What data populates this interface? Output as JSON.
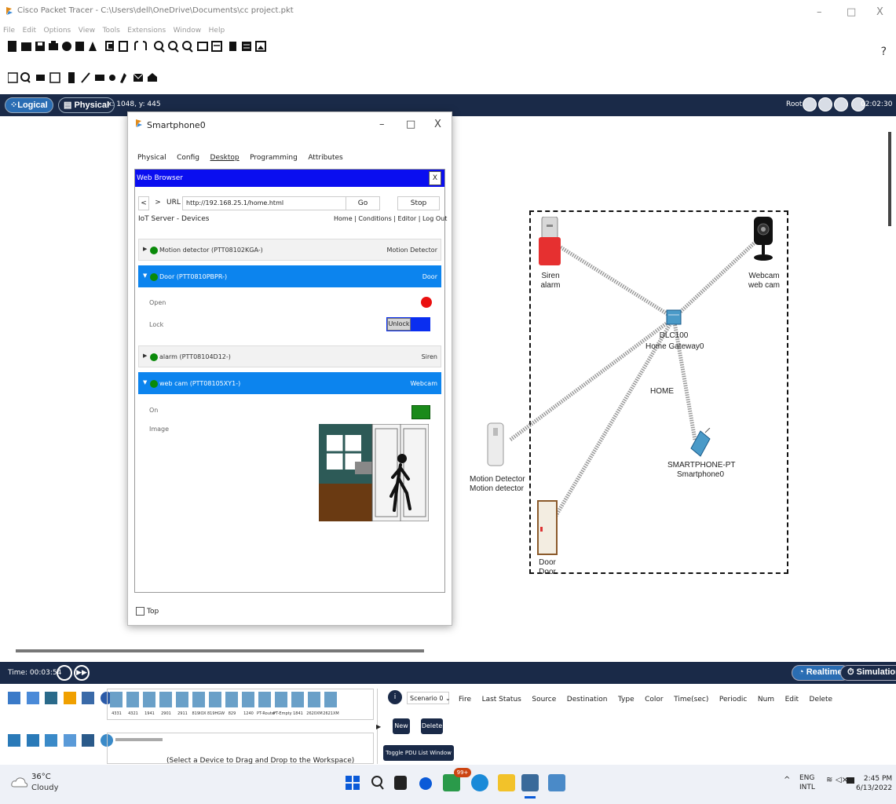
{
  "window": {
    "title": "Cisco Packet Tracer - C:\\Users\\dell\\OneDrive\\Documents\\cc project.pkt",
    "min": "–",
    "max": "□",
    "close": "X"
  },
  "menu": [
    "File",
    "Edit",
    "Options",
    "View",
    "Tools",
    "Extensions",
    "Window",
    "Help"
  ],
  "help_label": "?",
  "workspace_bar": {
    "logical_tab": "Logical",
    "physical_tab": "Physical",
    "coords": "x: 1048, y: 445",
    "root": "Root",
    "clock": "02:02:30"
  },
  "dialog": {
    "title": "Smartphone0",
    "min": "–",
    "max": "□",
    "close": "X",
    "tabs": [
      "Physical",
      "Config",
      "Desktop",
      "Programming",
      "Attributes"
    ],
    "active_tab": "Desktop",
    "browser": {
      "title": "Web Browser",
      "close": "X",
      "back": "<",
      "forward": ">",
      "url_label": "URL",
      "url": "http://192.168.25.1/home.html",
      "go": "Go",
      "stop": "Stop",
      "server_title": "IoT Server - Devices",
      "nav": "Home | Conditions | Editor | Log Out",
      "devices": [
        {
          "name": "Motion detector (PTT08102KGA-)",
          "type": "Motion Detector",
          "expanded": false
        },
        {
          "name": "Door (PTT0810PBPR-)",
          "type": "Door",
          "expanded": true
        },
        {
          "name": "alarm (PTT08104D12-)",
          "type": "Siren",
          "expanded": false
        },
        {
          "name": "web cam (PTT08105XY1-)",
          "type": "Webcam",
          "expanded": true
        }
      ],
      "door_props": {
        "open_label": "Open",
        "lock_label": "Lock",
        "unlock_btn": "Unlock"
      },
      "cam_props": {
        "on_label": "On",
        "image_label": "Image"
      }
    },
    "top_checkbox": "Top"
  },
  "diagram": {
    "siren": [
      "Siren",
      "alarm"
    ],
    "webcam": [
      "Webcam",
      "web cam"
    ],
    "gateway": [
      "DLC100",
      "Home Gateway0"
    ],
    "home_label": "HOME",
    "smartphone": [
      "SMARTPHONE-PT",
      "Smartphone0"
    ],
    "motion": [
      "Motion Detector",
      "Motion detector"
    ],
    "door": [
      "Door",
      "Door"
    ]
  },
  "bottom": {
    "time": "Time: 00:03:54",
    "realtime": "Realtime",
    "simulation": "Simulation",
    "scenario": "Scenario 0",
    "new_btn": "New",
    "delete_btn": "Delete",
    "toggle_btn": "Toggle PDU List Window",
    "pdu_columns": [
      "Fire",
      "Last Status",
      "Source",
      "Destination",
      "Type",
      "Color",
      "Time(sec)",
      "Periodic",
      "Num",
      "Edit",
      "Delete"
    ],
    "device_models": [
      "4331",
      "4321",
      "1941",
      "2901",
      "2911",
      "819IOX",
      "819HGW",
      "829",
      "1240",
      "PT-Router",
      "PT-Empty",
      "1841",
      "2620XM",
      "2621XM"
    ],
    "status_msg": "(Select a Device to Drag and Drop to the Workspace)"
  },
  "taskbar": {
    "temp": "36°C",
    "cond": "Cloudy",
    "lang1": "ENG",
    "lang2": "INTL",
    "time": "2:45 PM",
    "date": "6/13/2022",
    "badge": "99+"
  },
  "colors": {
    "dark_bar": "#1a2a48",
    "browser_bar": "#0a0ef0",
    "row_open": "#0c84ee",
    "status_green": "#0a8a0a"
  }
}
